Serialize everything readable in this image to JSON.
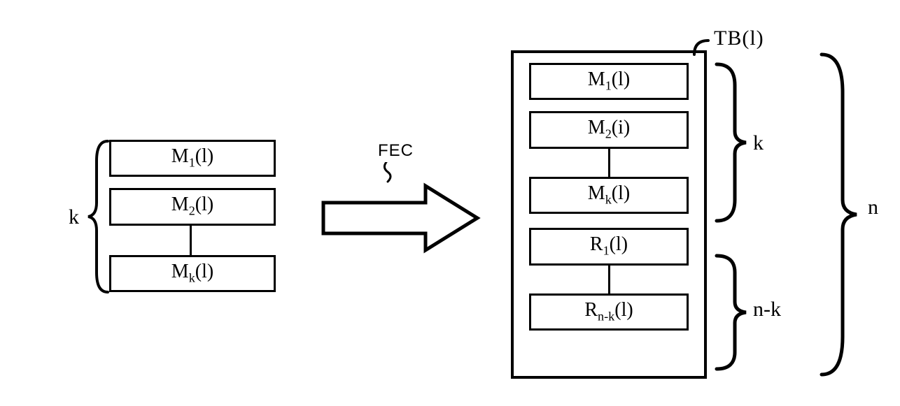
{
  "chart_data": {
    "type": "diagram",
    "title": "FEC encoding of k message blocks into a transport block TB(l) of n blocks",
    "process_label": "FEC",
    "input": {
      "count_label": "k",
      "blocks": [
        "M_1(l)",
        "M_2(l)",
        "M_k(l)"
      ],
      "ellipsis_between": [
        "M_2(l)",
        "M_k(l)"
      ]
    },
    "output": {
      "container_label": "TB(l)",
      "total_count_label": "n",
      "message_blocks": {
        "count_label": "k",
        "blocks": [
          "M_1(l)",
          "M_2(i)",
          "M_k(l)"
        ],
        "ellipsis_between": [
          "M_2(i)",
          "M_k(l)"
        ]
      },
      "redundancy_blocks": {
        "count_label": "n-k",
        "blocks": [
          "R_1(l)",
          "R_{n-k}(l)"
        ],
        "ellipsis_between": [
          "R_1(l)",
          "R_{n-k}(l)"
        ]
      }
    }
  },
  "left": {
    "k": "k",
    "m1": "M",
    "m1sub": "1",
    "m1arg": "(l)",
    "m2": "M",
    "m2sub": "2",
    "m2arg": "(l)",
    "mk": "M",
    "mksub": "k",
    "mkarg": "(l)"
  },
  "arrow": {
    "label": "FEC"
  },
  "tb": {
    "label": "TB(l)"
  },
  "right": {
    "m1": "M",
    "m1sub": "1",
    "m1arg": "(l)",
    "m2": "M",
    "m2sub": "2",
    "m2arg": "(i)",
    "mk": "M",
    "mksub": "k",
    "mkarg": "(l)",
    "r1": "R",
    "r1sub": "1",
    "r1arg": "(l)",
    "rnk": "R",
    "rnksub": "n-k",
    "rnkarg": "(l)",
    "k": "k",
    "nk": "n-k",
    "n": "n"
  }
}
